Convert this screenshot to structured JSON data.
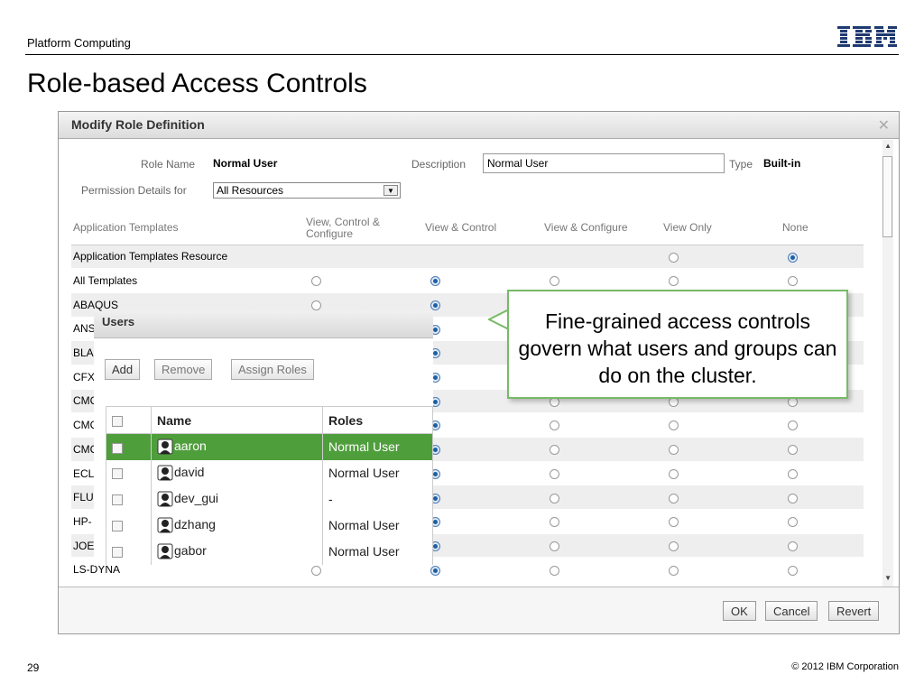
{
  "slide": {
    "header": "Platform Computing",
    "title": "Role-based Access Controls",
    "page_number": "29",
    "copyright": "© 2012 IBM Corporation",
    "logo": "IBM"
  },
  "dialog": {
    "title": "Modify Role Definition",
    "close_icon": "close-icon",
    "role_name_label": "Role Name",
    "role_name_value": "Normal User",
    "description_label": "Description",
    "description_value": "Normal User",
    "type_label": "Type",
    "type_value": "Built-in",
    "permission_label": "Permission Details for",
    "permission_selected": "All Resources",
    "table": {
      "headers": [
        "Application Templates",
        "View, Control & Configure",
        "View & Control",
        "View & Configure",
        "View Only",
        "None"
      ],
      "rows": [
        {
          "name": "Application Templates Resource",
          "radios": [
            null,
            null,
            null,
            false,
            true
          ]
        },
        {
          "name": "All Templates",
          "radios": [
            false,
            true,
            false,
            false,
            false
          ]
        },
        {
          "name": "ABAQUS",
          "radios": [
            false,
            true,
            null,
            null,
            null
          ]
        },
        {
          "name": "ANS",
          "radios": [
            null,
            true,
            null,
            null,
            null
          ]
        },
        {
          "name": "BLA",
          "radios": [
            null,
            true,
            null,
            null,
            null
          ]
        },
        {
          "name": "CFX",
          "radios": [
            null,
            true,
            null,
            null,
            null
          ]
        },
        {
          "name": "CMC",
          "radios": [
            null,
            true,
            false,
            false,
            false
          ]
        },
        {
          "name": "CMC",
          "radios": [
            null,
            true,
            false,
            false,
            false
          ]
        },
        {
          "name": "CMC",
          "radios": [
            null,
            true,
            false,
            false,
            false
          ]
        },
        {
          "name": "ECL",
          "radios": [
            null,
            true,
            false,
            false,
            false
          ]
        },
        {
          "name": "FLU",
          "radios": [
            null,
            true,
            false,
            false,
            false
          ]
        },
        {
          "name": "HP-",
          "radios": [
            null,
            true,
            false,
            false,
            false
          ]
        },
        {
          "name": "JOE",
          "radios": [
            null,
            true,
            false,
            false,
            false
          ]
        },
        {
          "name": "LS-DYNA",
          "radios": [
            false,
            true,
            false,
            false,
            false
          ]
        }
      ]
    },
    "buttons": {
      "ok": "OK",
      "cancel": "Cancel",
      "revert": "Revert"
    }
  },
  "users_panel": {
    "title": "Users",
    "buttons": {
      "add": "Add",
      "remove": "Remove",
      "assign_roles": "Assign Roles"
    },
    "columns": {
      "name": "Name",
      "roles": "Roles"
    },
    "users": [
      {
        "name": "aaron",
        "role": "Normal User",
        "selected": true
      },
      {
        "name": "david",
        "role": "Normal User",
        "selected": false
      },
      {
        "name": "dev_gui",
        "role": "-",
        "selected": false
      },
      {
        "name": "dzhang",
        "role": "Normal User",
        "selected": false
      },
      {
        "name": "gabor",
        "role": "Normal User",
        "selected": false
      }
    ]
  },
  "callout": {
    "text": "Fine-grained access controls govern what users and groups can do on the cluster."
  },
  "colors": {
    "selected_row": "#4f9e3c",
    "callout_border": "#77bb66",
    "radio_on": "#1d5fa3"
  }
}
